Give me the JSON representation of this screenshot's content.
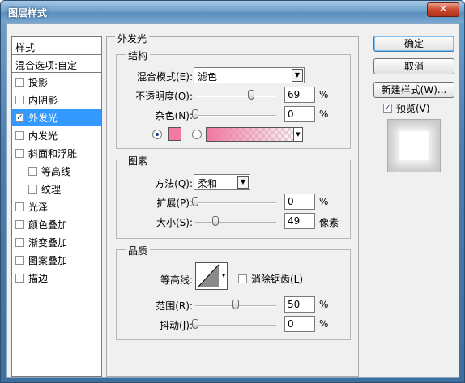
{
  "window": {
    "title": "图层样式",
    "close_label": "✕"
  },
  "style_list": {
    "header": "样式",
    "blend_options": "混合选项:自定",
    "items": [
      {
        "label": "投影",
        "checked": false,
        "sub": false,
        "selected": false
      },
      {
        "label": "内阴影",
        "checked": false,
        "sub": false,
        "selected": false
      },
      {
        "label": "外发光",
        "checked": true,
        "sub": false,
        "selected": true
      },
      {
        "label": "内发光",
        "checked": false,
        "sub": false,
        "selected": false
      },
      {
        "label": "斜面和浮雕",
        "checked": false,
        "sub": false,
        "selected": false
      },
      {
        "label": "等高线",
        "checked": false,
        "sub": true,
        "selected": false
      },
      {
        "label": "纹理",
        "checked": false,
        "sub": true,
        "selected": false
      },
      {
        "label": "光泽",
        "checked": false,
        "sub": false,
        "selected": false
      },
      {
        "label": "颜色叠加",
        "checked": false,
        "sub": false,
        "selected": false
      },
      {
        "label": "渐变叠加",
        "checked": false,
        "sub": false,
        "selected": false
      },
      {
        "label": "图案叠加",
        "checked": false,
        "sub": false,
        "selected": false
      },
      {
        "label": "描边",
        "checked": false,
        "sub": false,
        "selected": false
      }
    ]
  },
  "outer_glow": {
    "title": "外发光",
    "structure": {
      "title": "结构",
      "blend_mode_label": "混合模式(E):",
      "blend_mode_value": "滤色",
      "opacity_label": "不透明度(O):",
      "opacity_value": "69",
      "opacity_unit": "%",
      "opacity_fraction": 0.69,
      "noise_label": "杂色(N):",
      "noise_value": "0",
      "noise_unit": "%",
      "glow_color": "#f37aa5",
      "color_mode": "solid"
    },
    "elements": {
      "title": "图素",
      "technique_label": "方法(Q):",
      "technique_value": "柔和",
      "spread_label": "扩展(P):",
      "spread_value": "0",
      "spread_unit": "%",
      "size_label": "大小(S):",
      "size_value": "49",
      "size_unit": "像素"
    },
    "quality": {
      "title": "品质",
      "contour_label": "等高线:",
      "anti_alias_label": "消除锯齿(L)",
      "anti_alias_checked": false,
      "range_label": "范围(R):",
      "range_value": "50",
      "range_unit": "%",
      "jitter_label": "抖动(J):",
      "jitter_value": "0",
      "jitter_unit": "%"
    }
  },
  "buttons": {
    "ok": "确定",
    "cancel": "取消",
    "new_style": "新建样式(W)...",
    "preview_label": "预览(V)",
    "preview_checked": true
  }
}
